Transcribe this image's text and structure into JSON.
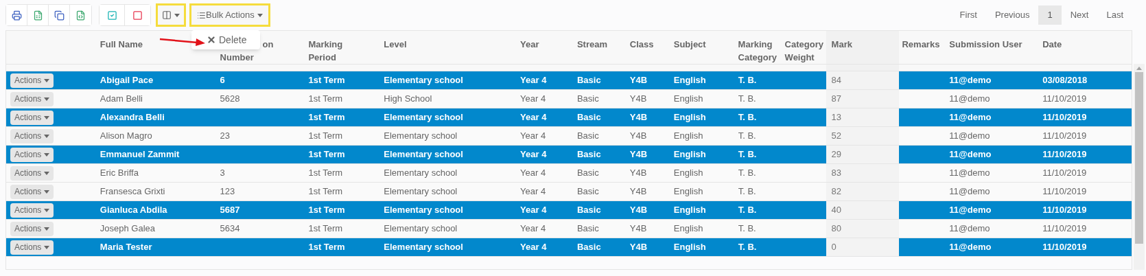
{
  "toolbar": {
    "column_button": {
      "highlighted": true
    },
    "bulk_actions_button": {
      "label": "Bulk Actions",
      "highlighted": true
    },
    "dropdown": {
      "items": [
        "Delete"
      ]
    }
  },
  "pagination": [
    {
      "label": "First",
      "selected": false
    },
    {
      "label": "Previous",
      "selected": false
    },
    {
      "label": "1",
      "selected": true
    },
    {
      "label": "Next",
      "selected": false
    },
    {
      "label": "Last",
      "selected": false
    }
  ],
  "table": {
    "columns": [
      "Full Name",
      "on Number",
      "Marking Period",
      "Level",
      "Year",
      "Stream",
      "Class",
      "Subject",
      "Marking Category",
      "Category Weight",
      "Mark",
      "Remarks",
      "Submission User",
      "Date"
    ],
    "rows": [
      {
        "selected": true,
        "actions": "Actions",
        "cells": [
          "Abigail Pace",
          "6",
          "1st Term",
          "Elementary school",
          "Year 4",
          "Basic",
          "Y4B",
          "English",
          "T. B.",
          "",
          "84",
          "",
          "11@demo",
          "03/08/2018"
        ]
      },
      {
        "selected": false,
        "actions": "Actions",
        "cells": [
          "Adam Belli",
          "5628",
          "1st Term",
          "High School",
          "Year 4",
          "Basic",
          "Y4B",
          "English",
          "T. B.",
          "",
          "87",
          "",
          "11@demo",
          "11/10/2019"
        ]
      },
      {
        "selected": true,
        "actions": "Actions",
        "cells": [
          "Alexandra Belli",
          "",
          "1st Term",
          "Elementary school",
          "Year 4",
          "Basic",
          "Y4B",
          "English",
          "T. B.",
          "",
          "13",
          "",
          "11@demo",
          "11/10/2019"
        ]
      },
      {
        "selected": false,
        "actions": "Actions",
        "cells": [
          "Alison Magro",
          "23",
          "1st Term",
          "Elementary school",
          "Year 4",
          "Basic",
          "Y4B",
          "English",
          "T. B.",
          "",
          "52",
          "",
          "11@demo",
          "11/10/2019"
        ]
      },
      {
        "selected": true,
        "actions": "Actions",
        "cells": [
          "Emmanuel Zammit",
          "",
          "1st Term",
          "Elementary school",
          "Year 4",
          "Basic",
          "Y4B",
          "English",
          "T. B.",
          "",
          "29",
          "",
          "11@demo",
          "11/10/2019"
        ]
      },
      {
        "selected": false,
        "actions": "Actions",
        "cells": [
          "Eric Briffa",
          "3",
          "1st Term",
          "Elementary school",
          "Year 4",
          "Basic",
          "Y4B",
          "English",
          "T. B.",
          "",
          "83",
          "",
          "11@demo",
          "11/10/2019"
        ]
      },
      {
        "selected": false,
        "actions": "Actions",
        "cells": [
          "Fransesca Grixti",
          "123",
          "1st Term",
          "Elementary school",
          "Year 4",
          "Basic",
          "Y4B",
          "English",
          "T. B.",
          "",
          "82",
          "",
          "11@demo",
          "11/10/2019"
        ]
      },
      {
        "selected": true,
        "actions": "Actions",
        "cells": [
          "Gianluca Abdila",
          "5687",
          "1st Term",
          "Elementary school",
          "Year 4",
          "Basic",
          "Y4B",
          "English",
          "T. B.",
          "",
          "40",
          "",
          "11@demo",
          "11/10/2019"
        ]
      },
      {
        "selected": false,
        "actions": "Actions",
        "cells": [
          "Joseph Galea",
          "5634",
          "1st Term",
          "Elementary school",
          "Year 4",
          "Basic",
          "Y4B",
          "English",
          "T. B.",
          "",
          "80",
          "",
          "11@demo",
          "11/10/2019"
        ]
      },
      {
        "selected": true,
        "actions": "Actions",
        "cells": [
          "Maria Tester",
          "",
          "1st Term",
          "Elementary school",
          "Year 4",
          "Basic",
          "Y4B",
          "English",
          "T. B.",
          "",
          "0",
          "",
          "11@demo",
          "11/10/2019"
        ]
      }
    ]
  }
}
